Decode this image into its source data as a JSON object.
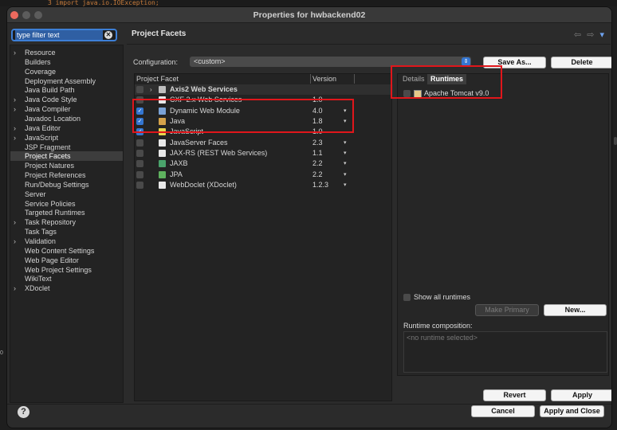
{
  "editor_line": "3 import java.io.IOException;",
  "gutter_text": "0",
  "window": {
    "title": "Properties for hwbackend02"
  },
  "filter": {
    "placeholder": "type filter text"
  },
  "tree": [
    {
      "label": "Resource",
      "expandable": true
    },
    {
      "label": "Builders",
      "expandable": false
    },
    {
      "label": "Coverage",
      "expandable": false
    },
    {
      "label": "Deployment Assembly",
      "expandable": false
    },
    {
      "label": "Java Build Path",
      "expandable": false
    },
    {
      "label": "Java Code Style",
      "expandable": true
    },
    {
      "label": "Java Compiler",
      "expandable": true
    },
    {
      "label": "Javadoc Location",
      "expandable": false
    },
    {
      "label": "Java Editor",
      "expandable": true
    },
    {
      "label": "JavaScript",
      "expandable": true
    },
    {
      "label": "JSP Fragment",
      "expandable": false
    },
    {
      "label": "Project Facets",
      "expandable": false,
      "selected": true
    },
    {
      "label": "Project Natures",
      "expandable": false
    },
    {
      "label": "Project References",
      "expandable": false
    },
    {
      "label": "Run/Debug Settings",
      "expandable": false
    },
    {
      "label": "Server",
      "expandable": false
    },
    {
      "label": "Service Policies",
      "expandable": false
    },
    {
      "label": "Targeted Runtimes",
      "expandable": false
    },
    {
      "label": "Task Repository",
      "expandable": true
    },
    {
      "label": "Task Tags",
      "expandable": false
    },
    {
      "label": "Validation",
      "expandable": true
    },
    {
      "label": "Web Content Settings",
      "expandable": false
    },
    {
      "label": "Web Page Editor",
      "expandable": false
    },
    {
      "label": "Web Project Settings",
      "expandable": false
    },
    {
      "label": "WikiText",
      "expandable": false
    },
    {
      "label": "XDoclet",
      "expandable": true
    }
  ],
  "main": {
    "page_title": "Project Facets",
    "nav": {
      "back": "⇦",
      "forward": "⇨",
      "menu": "▾"
    },
    "config_label": "Configuration:",
    "config_value": "<custom>",
    "save_as": "Save As...",
    "delete": "Delete",
    "table_headers": {
      "facet": "Project Facet",
      "version": "Version"
    },
    "facets": [
      {
        "name": "Axis2 Web Services",
        "version": "",
        "checked": false,
        "group": true,
        "icon": "folder-icon"
      },
      {
        "name": "CXF 2.x Web Services",
        "version": "1.0",
        "checked": false,
        "icon": "document-icon"
      },
      {
        "name": "Dynamic Web Module",
        "version": "4.0",
        "checked": true,
        "icon": "module-icon",
        "dropdown": true
      },
      {
        "name": "Java",
        "version": "1.8",
        "checked": true,
        "icon": "java-icon",
        "dropdown": true
      },
      {
        "name": "JavaScript",
        "version": "1.0",
        "checked": true,
        "icon": "javascript-icon"
      },
      {
        "name": "JavaServer Faces",
        "version": "2.3",
        "checked": false,
        "icon": "document-icon",
        "dropdown": true
      },
      {
        "name": "JAX-RS (REST Web Services)",
        "version": "1.1",
        "checked": false,
        "icon": "document-icon",
        "dropdown": true
      },
      {
        "name": "JAXB",
        "version": "2.2",
        "checked": false,
        "icon": "jaxb-icon",
        "dropdown": true
      },
      {
        "name": "JPA",
        "version": "2.2",
        "checked": false,
        "icon": "jpa-icon",
        "dropdown": true
      },
      {
        "name": "WebDoclet (XDoclet)",
        "version": "1.2.3",
        "checked": false,
        "icon": "document-icon",
        "dropdown": true
      }
    ],
    "tabs": {
      "details": "Details",
      "runtimes": "Runtimes"
    },
    "runtime": {
      "name": "Apache Tomcat v9.0",
      "icon": "tomcat-icon"
    },
    "show_all_runtimes": "Show all runtimes",
    "make_primary": "Make Primary",
    "new_runtime": "New...",
    "runtime_composition_label": "Runtime composition:",
    "runtime_composition_value": "<no runtime selected>",
    "revert": "Revert",
    "apply": "Apply"
  },
  "footer": {
    "cancel": "Cancel",
    "apply_close": "Apply and Close",
    "help_icon": "question-icon"
  },
  "colors": {
    "highlight": "#e0161b",
    "accent": "#3476d1",
    "background": "#2b2b2b"
  }
}
